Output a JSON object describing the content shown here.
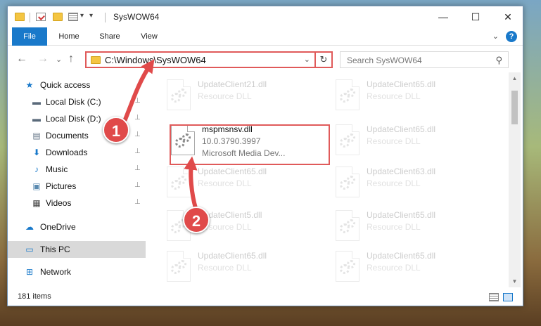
{
  "window": {
    "title": "SysWOW64",
    "minimize_glyph": "—",
    "maximize_glyph": "☐",
    "close_glyph": "✕"
  },
  "ribbon": {
    "tabs": [
      "File",
      "Home",
      "Share",
      "View"
    ],
    "expand_glyph": "⌄",
    "help_glyph": "?"
  },
  "nav": {
    "back_glyph": "←",
    "forward_glyph": "→",
    "recent_glyph": "⌄",
    "up_glyph": "↑",
    "address": "C:\\Windows\\SysWOW64",
    "address_dropdown_glyph": "⌄",
    "refresh_glyph": "↻",
    "search_placeholder": "Search SysWOW64",
    "search_glyph": "⚲"
  },
  "sidebar": {
    "items": [
      {
        "label": "Quick access",
        "icon": "star-icon",
        "glyph": "★"
      },
      {
        "label": "Local Disk (C:)",
        "icon": "drive-icon",
        "glyph": "▬",
        "pinned": true
      },
      {
        "label": "Local Disk (D:)",
        "icon": "drive-icon",
        "glyph": "▬",
        "pinned": true
      },
      {
        "label": "Documents",
        "icon": "documents-icon",
        "glyph": "▤",
        "pinned": true
      },
      {
        "label": "Downloads",
        "icon": "download-icon",
        "glyph": "⬇",
        "pinned": true
      },
      {
        "label": "Music",
        "icon": "music-icon",
        "glyph": "♪",
        "pinned": true
      },
      {
        "label": "Pictures",
        "icon": "pictures-icon",
        "glyph": "▣",
        "pinned": true
      },
      {
        "label": "Videos",
        "icon": "video-icon",
        "glyph": "▦",
        "pinned": true
      },
      {
        "label": "OneDrive",
        "icon": "cloud-icon",
        "glyph": "☁"
      },
      {
        "label": "This PC",
        "icon": "computer-icon",
        "glyph": "▭",
        "selected": true
      },
      {
        "label": "Network",
        "icon": "network-icon",
        "glyph": "⊞"
      }
    ],
    "pin_glyph": "📌"
  },
  "files": {
    "faded": [
      {
        "name": "UpdateClient21.dll",
        "type": "Resource DLL"
      },
      {
        "name": "UpdateClient65.dll",
        "type": "Resource DLL"
      },
      {
        "name": "UpdateClient65.dll",
        "type": "Resource DLL"
      },
      {
        "name": "UpdateClient65.dll",
        "type": "Resource DLL"
      },
      {
        "name": "UpdateClient63.dll",
        "type": "Resource DLL"
      },
      {
        "name": "UpdateClient5.dll",
        "type": "Resource DLL"
      },
      {
        "name": "UpdateClient65.dll",
        "type": "Resource DLL"
      },
      {
        "name": "UpdateClient65.dll",
        "type": "Resource DLL"
      },
      {
        "name": "UpdateClient65.dll",
        "type": "Resource DLL"
      }
    ],
    "selected": {
      "name": "mspmsnsv.dll",
      "version": "10.0.3790.3997",
      "description": "Microsoft Media Dev..."
    }
  },
  "status": {
    "item_count": "181 items"
  },
  "annotations": {
    "step1": "1",
    "step2": "2",
    "color": "#e04a4a"
  }
}
